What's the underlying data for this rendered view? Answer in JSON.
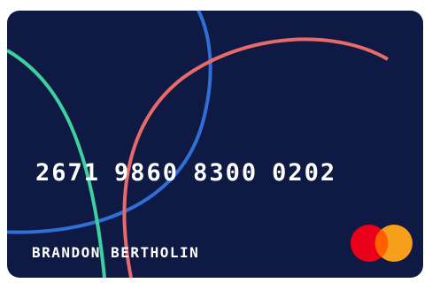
{
  "card": {
    "number_groups": [
      "2671",
      "9860",
      "8300",
      "0202"
    ],
    "holder_name": "BRANDON BERTHOLIN",
    "brand_logo": "mastercard-logo-icon",
    "colors": {
      "background": "#0f1a44",
      "arc_blue": "#2f6fd6",
      "arc_green": "#3fd0a0",
      "arc_red": "#e86a6a",
      "logo_red": "#eb001b",
      "logo_orange": "#f79e1b"
    }
  }
}
